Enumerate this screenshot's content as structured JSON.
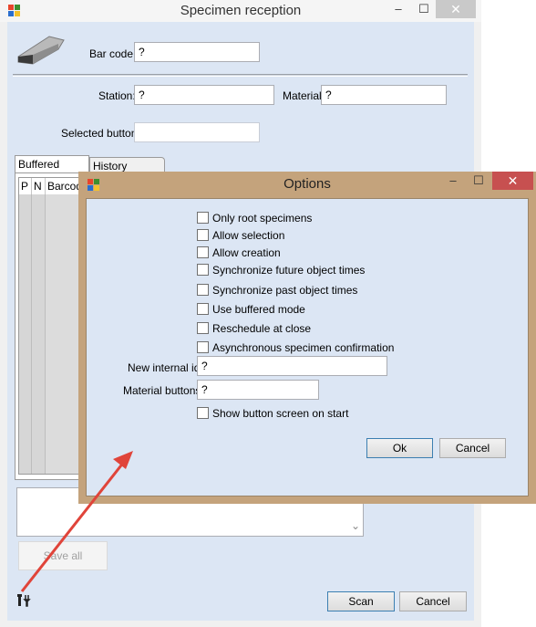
{
  "main": {
    "title": "Specimen reception",
    "minimize_glyph": "–",
    "maximize_glyph": "☐",
    "close_glyph": "✕",
    "barcode_label": "Bar code:",
    "barcode_value": "?",
    "station_label": "Station:",
    "station_value": "?",
    "material_label": "Material:",
    "material_value": "?",
    "selected_button_label": "Selected button:",
    "selected_button_value": "",
    "tabs": [
      {
        "label": "Buffered Mode",
        "selected": true
      },
      {
        "label": "History",
        "selected": false
      }
    ],
    "grid_columns": [
      "P",
      "N",
      "Barcode"
    ],
    "save_all_label": "Save all",
    "scan_label": "Scan",
    "cancel_label": "Cancel",
    "scroll_down_glyph": "⌄"
  },
  "options": {
    "title": "Options",
    "minimize_glyph": "–",
    "maximize_glyph": "☐",
    "close_glyph": "✕",
    "checkboxes": [
      {
        "label": "Only root specimens",
        "checked": false
      },
      {
        "label": "Allow selection",
        "checked": false
      },
      {
        "label": "Allow creation",
        "checked": false
      },
      {
        "label": "Synchronize future object times",
        "checked": false
      },
      {
        "label": "Synchronize past object times",
        "checked": false
      },
      {
        "label": "Use buffered mode",
        "checked": false
      },
      {
        "label": "Reschedule at close",
        "checked": false
      },
      {
        "label": "Asynchronous specimen confirmation",
        "checked": false
      }
    ],
    "new_internal_id_label": "New internal id:",
    "new_internal_id_value": "?",
    "material_buttons_label": "Material buttons:",
    "material_buttons_value": "?",
    "show_button_screen": {
      "label": "Show button screen on start",
      "checked": false
    },
    "ok_label": "Ok",
    "cancel_label": "Cancel"
  },
  "colors": {
    "client_bg": "#dce6f4",
    "dialog_frame": "#c4a37c",
    "dialog_close": "#c75050",
    "annotation_arrow": "#e0443a"
  },
  "icons": {
    "app_icon": "app-icon",
    "scanner_icon": "barcode-scanner-icon",
    "settings_icon": "tools-icon"
  }
}
